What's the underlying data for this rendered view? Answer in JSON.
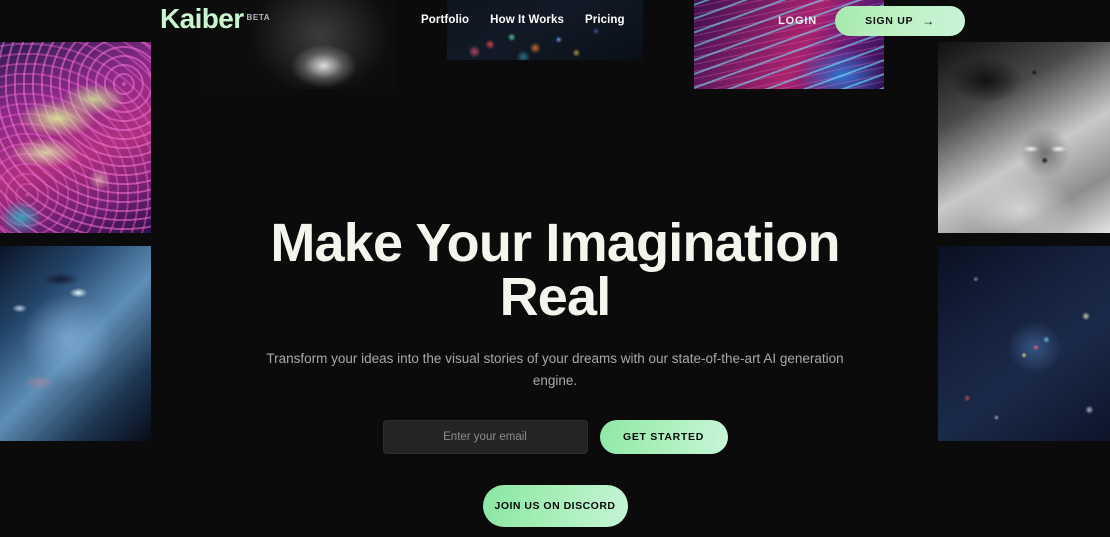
{
  "brand": {
    "name": "Kaiber",
    "beta_badge": "BETA",
    "logo_color": "#c9f5cf"
  },
  "nav": {
    "links": [
      {
        "label": "Portfolio"
      },
      {
        "label": "How It Works"
      },
      {
        "label": "Pricing"
      }
    ],
    "login_label": "LOGIN",
    "signup_label": "SIGN UP",
    "signup_arrow": "→",
    "signup_color": "#bdf2c3"
  },
  "hero": {
    "title": "Make Your Imagination Real",
    "subtitle": "Transform your ideas into the visual stories of your dreams with our state-of-the-art AI generation engine.",
    "email_placeholder": "Enter your email",
    "email_value": "",
    "cta_label": "GET STARTED",
    "discord_label": "JOIN US ON DISCORD",
    "accent_color": "#a9efb9",
    "title_color": "#f2f6ec",
    "subtitle_color": "#a8a8a8"
  },
  "gallery": {
    "top": [
      {
        "name": "portrait-monochrome-lips"
      },
      {
        "name": "dark-colorful-bokeh-particles"
      },
      {
        "name": "magenta-cyan-wave-lines"
      }
    ],
    "left": [
      {
        "name": "psychedelic-astronaut-clouds"
      },
      {
        "name": "blue-toned-woman-portrait"
      }
    ],
    "right": [
      {
        "name": "monochrome-foxes-in-smoke"
      },
      {
        "name": "dark-blue-cosmic-abstract"
      }
    ]
  },
  "page": {
    "background_color": "#0b0b0b"
  }
}
